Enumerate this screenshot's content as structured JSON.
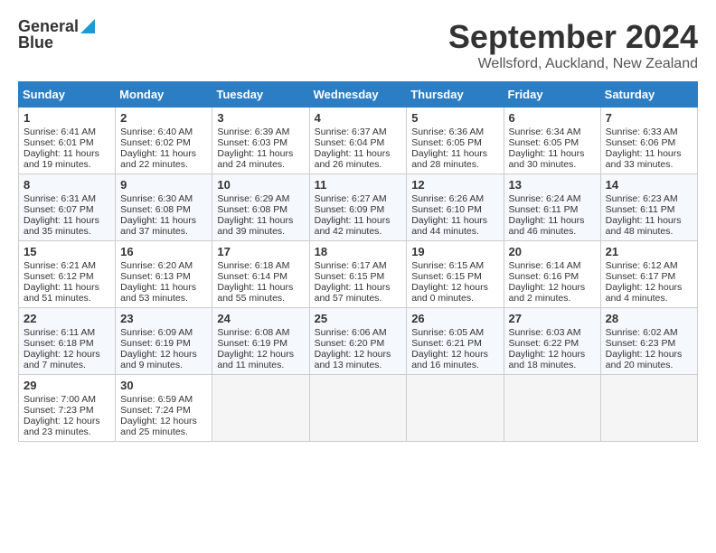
{
  "header": {
    "logo_line1": "General",
    "logo_line2": "Blue",
    "title": "September 2024",
    "subtitle": "Wellsford, Auckland, New Zealand"
  },
  "days_of_week": [
    "Sunday",
    "Monday",
    "Tuesday",
    "Wednesday",
    "Thursday",
    "Friday",
    "Saturday"
  ],
  "weeks": [
    [
      {
        "day": 1,
        "sunrise": "6:41 AM",
        "sunset": "6:01 PM",
        "daylight": "11 hours and 19 minutes."
      },
      {
        "day": 2,
        "sunrise": "6:40 AM",
        "sunset": "6:02 PM",
        "daylight": "11 hours and 22 minutes."
      },
      {
        "day": 3,
        "sunrise": "6:39 AM",
        "sunset": "6:03 PM",
        "daylight": "11 hours and 24 minutes."
      },
      {
        "day": 4,
        "sunrise": "6:37 AM",
        "sunset": "6:04 PM",
        "daylight": "11 hours and 26 minutes."
      },
      {
        "day": 5,
        "sunrise": "6:36 AM",
        "sunset": "6:05 PM",
        "daylight": "11 hours and 28 minutes."
      },
      {
        "day": 6,
        "sunrise": "6:34 AM",
        "sunset": "6:05 PM",
        "daylight": "11 hours and 30 minutes."
      },
      {
        "day": 7,
        "sunrise": "6:33 AM",
        "sunset": "6:06 PM",
        "daylight": "11 hours and 33 minutes."
      }
    ],
    [
      {
        "day": 8,
        "sunrise": "6:31 AM",
        "sunset": "6:07 PM",
        "daylight": "11 hours and 35 minutes."
      },
      {
        "day": 9,
        "sunrise": "6:30 AM",
        "sunset": "6:08 PM",
        "daylight": "11 hours and 37 minutes."
      },
      {
        "day": 10,
        "sunrise": "6:29 AM",
        "sunset": "6:08 PM",
        "daylight": "11 hours and 39 minutes."
      },
      {
        "day": 11,
        "sunrise": "6:27 AM",
        "sunset": "6:09 PM",
        "daylight": "11 hours and 42 minutes."
      },
      {
        "day": 12,
        "sunrise": "6:26 AM",
        "sunset": "6:10 PM",
        "daylight": "11 hours and 44 minutes."
      },
      {
        "day": 13,
        "sunrise": "6:24 AM",
        "sunset": "6:11 PM",
        "daylight": "11 hours and 46 minutes."
      },
      {
        "day": 14,
        "sunrise": "6:23 AM",
        "sunset": "6:11 PM",
        "daylight": "11 hours and 48 minutes."
      }
    ],
    [
      {
        "day": 15,
        "sunrise": "6:21 AM",
        "sunset": "6:12 PM",
        "daylight": "11 hours and 51 minutes."
      },
      {
        "day": 16,
        "sunrise": "6:20 AM",
        "sunset": "6:13 PM",
        "daylight": "11 hours and 53 minutes."
      },
      {
        "day": 17,
        "sunrise": "6:18 AM",
        "sunset": "6:14 PM",
        "daylight": "11 hours and 55 minutes."
      },
      {
        "day": 18,
        "sunrise": "6:17 AM",
        "sunset": "6:15 PM",
        "daylight": "11 hours and 57 minutes."
      },
      {
        "day": 19,
        "sunrise": "6:15 AM",
        "sunset": "6:15 PM",
        "daylight": "12 hours and 0 minutes."
      },
      {
        "day": 20,
        "sunrise": "6:14 AM",
        "sunset": "6:16 PM",
        "daylight": "12 hours and 2 minutes."
      },
      {
        "day": 21,
        "sunrise": "6:12 AM",
        "sunset": "6:17 PM",
        "daylight": "12 hours and 4 minutes."
      }
    ],
    [
      {
        "day": 22,
        "sunrise": "6:11 AM",
        "sunset": "6:18 PM",
        "daylight": "12 hours and 7 minutes."
      },
      {
        "day": 23,
        "sunrise": "6:09 AM",
        "sunset": "6:19 PM",
        "daylight": "12 hours and 9 minutes."
      },
      {
        "day": 24,
        "sunrise": "6:08 AM",
        "sunset": "6:19 PM",
        "daylight": "12 hours and 11 minutes."
      },
      {
        "day": 25,
        "sunrise": "6:06 AM",
        "sunset": "6:20 PM",
        "daylight": "12 hours and 13 minutes."
      },
      {
        "day": 26,
        "sunrise": "6:05 AM",
        "sunset": "6:21 PM",
        "daylight": "12 hours and 16 minutes."
      },
      {
        "day": 27,
        "sunrise": "6:03 AM",
        "sunset": "6:22 PM",
        "daylight": "12 hours and 18 minutes."
      },
      {
        "day": 28,
        "sunrise": "6:02 AM",
        "sunset": "6:23 PM",
        "daylight": "12 hours and 20 minutes."
      }
    ],
    [
      {
        "day": 29,
        "sunrise": "7:00 AM",
        "sunset": "7:23 PM",
        "daylight": "12 hours and 23 minutes."
      },
      {
        "day": 30,
        "sunrise": "6:59 AM",
        "sunset": "7:24 PM",
        "daylight": "12 hours and 25 minutes."
      },
      null,
      null,
      null,
      null,
      null
    ]
  ],
  "labels": {
    "sunrise": "Sunrise:",
    "sunset": "Sunset:",
    "daylight": "Daylight:"
  }
}
